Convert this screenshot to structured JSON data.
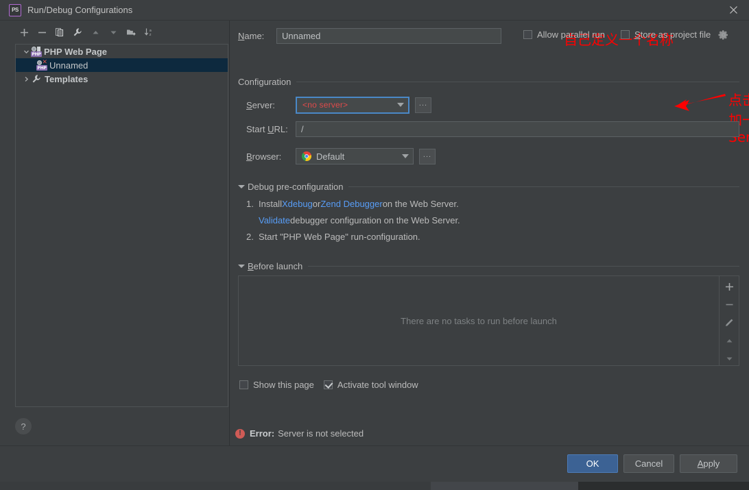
{
  "window": {
    "title": "Run/Debug Configurations",
    "app_badge": "PS",
    "close_icon": "close-icon"
  },
  "tree_toolbar": [
    {
      "name": "add-configuration-button",
      "icon": "plus-icon"
    },
    {
      "name": "remove-configuration-button",
      "icon": "minus-icon"
    },
    {
      "name": "copy-configuration-button",
      "icon": "copy-icon"
    },
    {
      "name": "edit-templates-button",
      "icon": "wrench-icon"
    },
    {
      "name": "move-up-button",
      "icon": "arrow-up-icon"
    },
    {
      "name": "move-down-button",
      "icon": "arrow-down-icon"
    },
    {
      "name": "move-into-folder-button",
      "icon": "new-folder-icon"
    },
    {
      "name": "sort-configurations-button",
      "icon": "sort-az-icon"
    }
  ],
  "tree": {
    "items": [
      {
        "label": "PHP Web Page",
        "icon": "php-web-page-icon",
        "twisty": "chevron-down",
        "selected": false,
        "bold": true,
        "level": 0
      },
      {
        "label": "Unnamed",
        "icon": "php-web-page-error-icon",
        "twisty": "",
        "selected": true,
        "bold": false,
        "level": 1
      },
      {
        "label": "Templates",
        "icon": "wrench-icon",
        "twisty": "chevron-right",
        "selected": false,
        "bold": true,
        "level": 0
      }
    ]
  },
  "help_button": {
    "label": "?",
    "name": "help-button"
  },
  "name_row": {
    "label": "Name:",
    "label_accel": "N",
    "value": "Unnamed",
    "placeholder": "Unnamed",
    "annotation": "自己定义一个名称",
    "allow_parallel_run": {
      "label": "Allow parallel run",
      "checked": false
    },
    "store_as_project_file": {
      "label": "Store as project file",
      "checked": false
    },
    "gear_icon": "gear-icon"
  },
  "configuration_section": {
    "title": "Configuration",
    "server": {
      "label": "Server:",
      "value": "<no server>",
      "value_color": "#e04a4a",
      "focus_color": "#4a88c7",
      "browse_label": "...",
      "annotation": "点击添加一个Server"
    },
    "start_url": {
      "label": "Start URL:",
      "value": "/"
    },
    "browser": {
      "label": "Browser:",
      "value": "Default",
      "icon": "chrome-icon",
      "browse_label": "..."
    }
  },
  "debug_preconfiguration": {
    "title": "Debug pre-configuration",
    "steps": [
      {
        "num": "1.",
        "prefix": "Install ",
        "link1": "Xdebug",
        "mid": " or ",
        "link2": "Zend Debugger",
        "suffix": " on the Web Server."
      },
      {
        "num": "2.",
        "prefix": "Start \"PHP Web Page\" run-configuration.",
        "link1": "",
        "mid": "",
        "link2": "",
        "suffix": ""
      }
    ],
    "validate_line": {
      "link": "Validate",
      "text": " debugger configuration on the Web Server."
    }
  },
  "before_launch": {
    "title": "Before launch",
    "title_accel": "B",
    "empty_text": "There are no tasks to run before launch",
    "tools": [
      {
        "name": "add-task-button",
        "icon": "plus-icon"
      },
      {
        "name": "remove-task-button",
        "icon": "minus-icon"
      },
      {
        "name": "edit-task-button",
        "icon": "pencil-icon"
      },
      {
        "name": "move-task-up-button",
        "icon": "arrow-up-icon"
      },
      {
        "name": "move-task-down-button",
        "icon": "arrow-down-icon"
      }
    ]
  },
  "bottom_options": {
    "show_this_page": {
      "label": "Show this page",
      "checked": false
    },
    "activate_tool_window": {
      "label": "Activate tool window",
      "checked": true
    }
  },
  "error": {
    "word": "Error:",
    "message": "Server is not selected",
    "color": "#cf5b56"
  },
  "footer": {
    "ok": "OK",
    "cancel": "Cancel",
    "apply": "Apply",
    "apply_accel": "A",
    "ok_color": "#3c6294"
  }
}
